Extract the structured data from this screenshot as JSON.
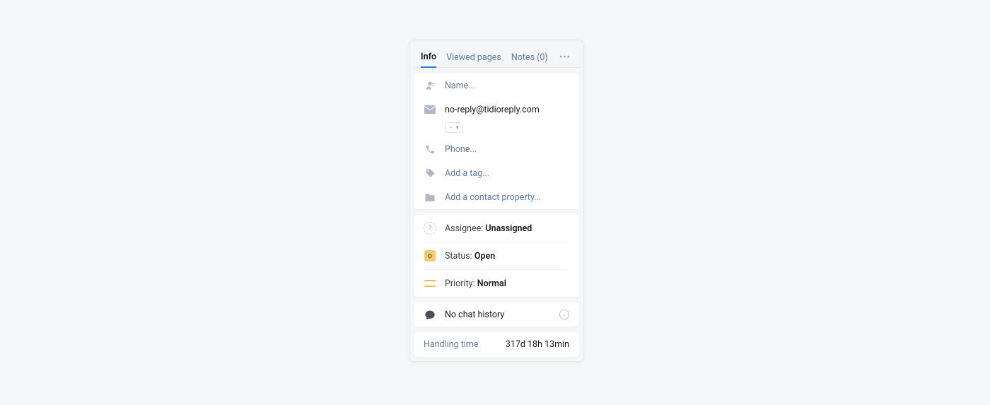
{
  "tabs": {
    "info": "Info",
    "viewed": "Viewed pages",
    "notes": "Notes (0)"
  },
  "contact": {
    "name_placeholder": "Name...",
    "email": "no-reply@tidioreply.com",
    "country_select": "-",
    "phone_placeholder": "Phone...",
    "tag_placeholder": "Add a tag...",
    "property_placeholder": "Add a contact property..."
  },
  "meta": {
    "assignee_label": "Assignee: ",
    "assignee_value": "Unassigned",
    "status_label": "Status: ",
    "status_value": "Open",
    "status_badge": "O",
    "priority_label": "Priority: ",
    "priority_value": "Normal"
  },
  "history": {
    "text": "No chat history"
  },
  "handling": {
    "label": "Handling time",
    "value": "317d 18h 13min"
  }
}
